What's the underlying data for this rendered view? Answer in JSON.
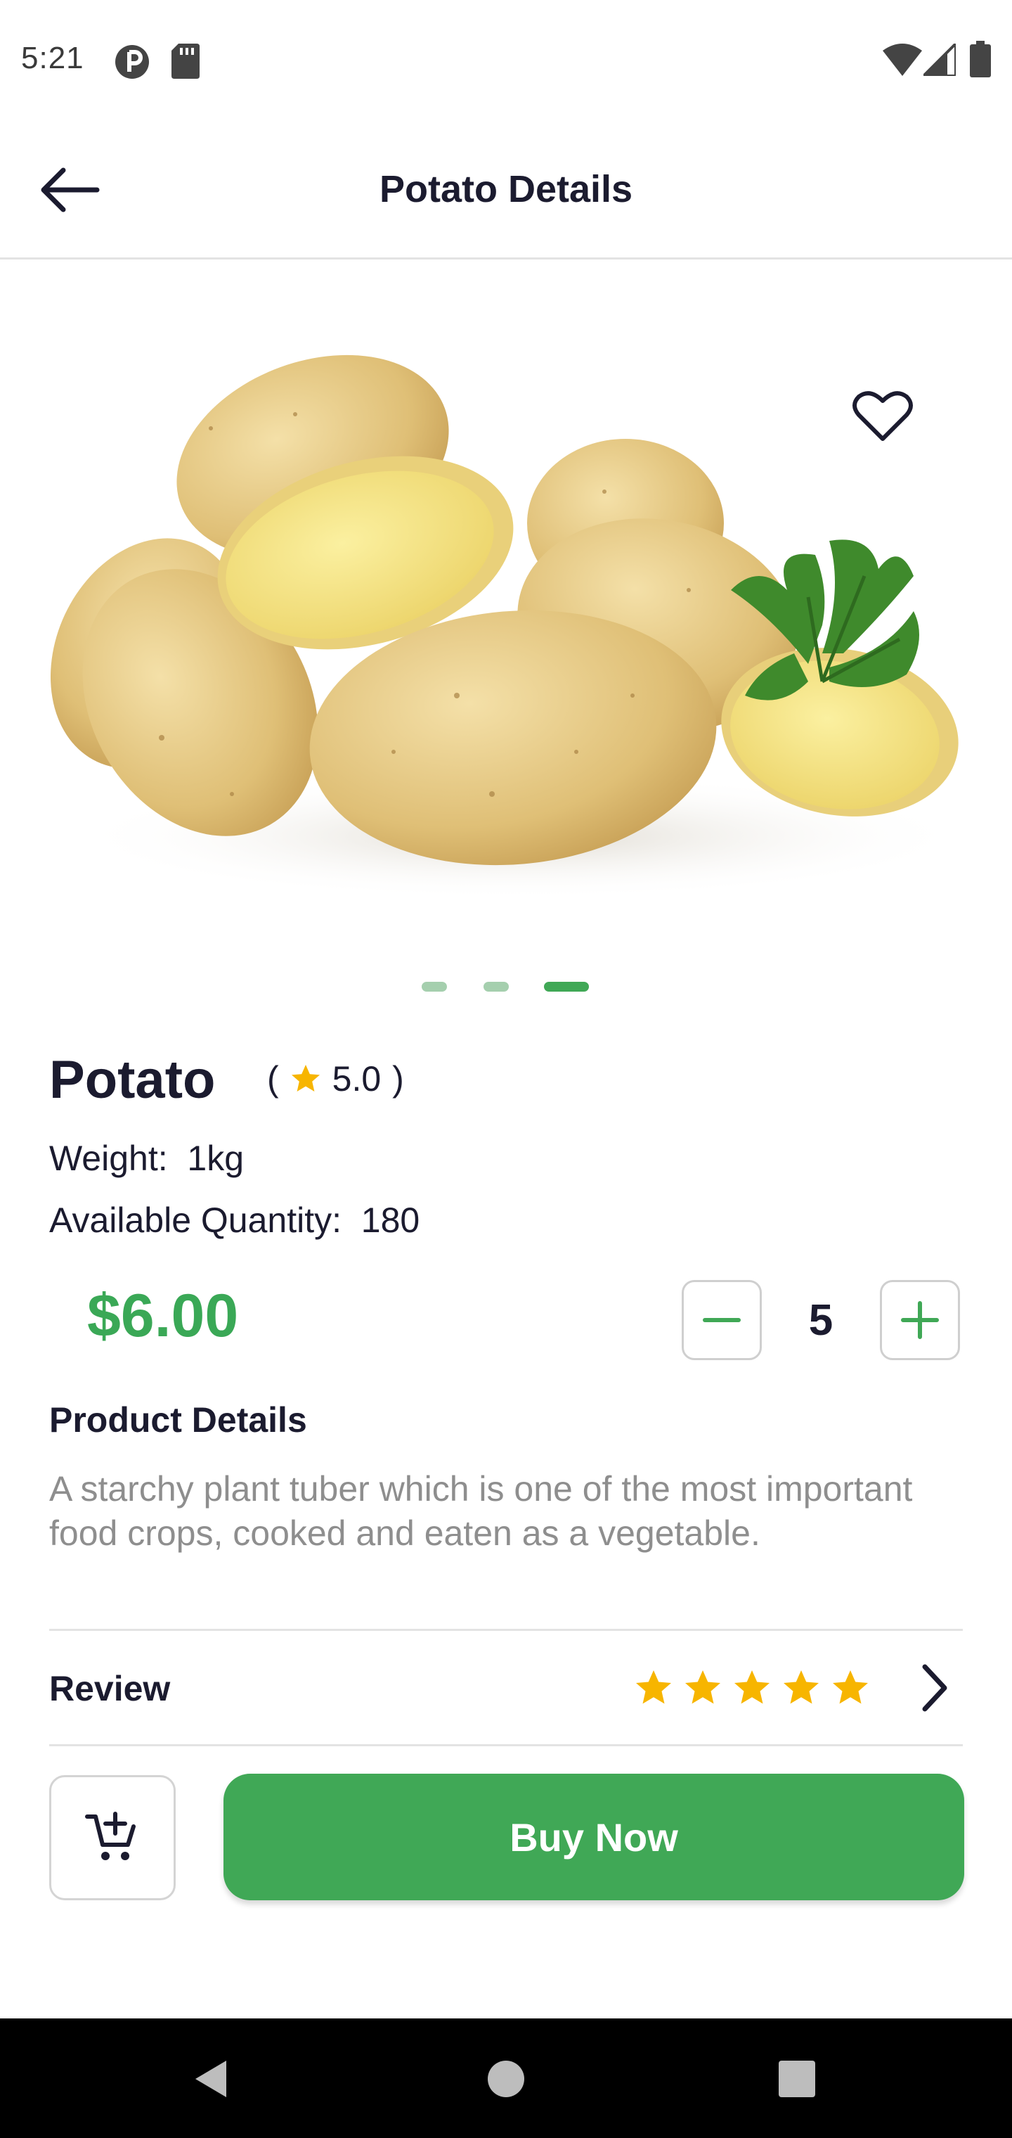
{
  "status_bar": {
    "time": "5:21",
    "left_icons": [
      "data-saver-icon",
      "sd-card-icon"
    ],
    "right_icons": [
      "wifi-icon",
      "cell-signal-icon",
      "battery-icon"
    ]
  },
  "app_bar": {
    "title": "Potato Details",
    "back_icon": "arrow-left-icon"
  },
  "product": {
    "image_icon": "potato-image",
    "favorite_icon": "heart-outline-icon",
    "carousel": {
      "count": 3,
      "active_index": 2
    },
    "name": "Potato",
    "rating_open": "(",
    "rating": "5.0",
    "rating_close": ")",
    "weight_label": "Weight:",
    "weight_value": "1kg",
    "quantity_label": "Available Quantity:",
    "quantity_value": "180",
    "price": "$6.00",
    "qty_selected": "5",
    "details_heading": "Product Details",
    "details_text": "A starchy plant tuber which is one of the most important food crops, cooked and eaten as a vegetable.",
    "review_label": "Review",
    "review_stars": 5
  },
  "actions": {
    "cart_icon": "add-to-cart-icon",
    "buy_label": "Buy Now"
  },
  "colors": {
    "accent": "#40a856",
    "price": "#3aa856",
    "star": "#f7b500",
    "text": "#1b1b2f",
    "muted": "#8e8e8e"
  },
  "nav_bar": {
    "icons": [
      "back-triangle-icon",
      "home-circle-icon",
      "recents-square-icon"
    ]
  }
}
